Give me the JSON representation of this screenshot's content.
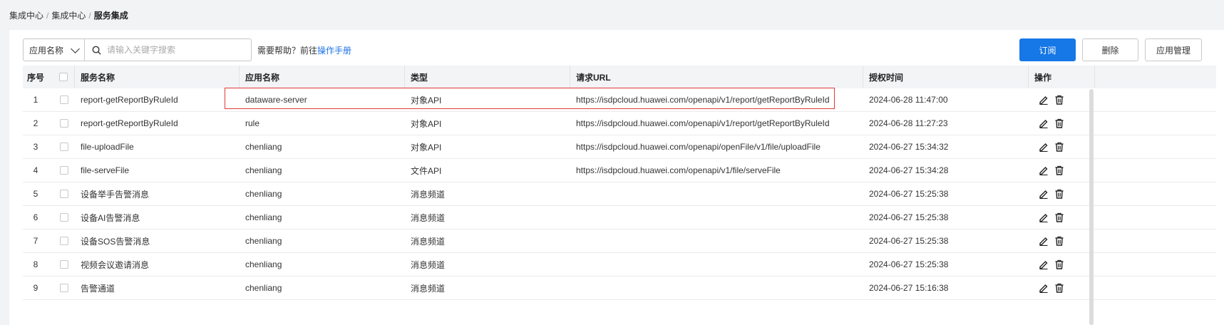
{
  "breadcrumb": {
    "items": [
      "集成中心",
      "集成中心",
      "服务集成"
    ],
    "separator": "/"
  },
  "toolbar": {
    "select_value": "应用名称",
    "search_placeholder": "请输入关键字搜索",
    "help_text": "需要帮助？前往",
    "help_link": "操作手册",
    "subscribe_label": "订阅",
    "delete_label": "删除",
    "manage_label": "应用管理"
  },
  "table": {
    "headers": {
      "no": "序号",
      "name": "服务名称",
      "app": "应用名称",
      "type": "类型",
      "url": "请求URL",
      "time": "授权时间",
      "op": "操作"
    },
    "rows": [
      {
        "no": "1",
        "name": "report-getReportByRuleId",
        "app": "dataware-server",
        "type": "对象API",
        "url": "https://isdpcloud.huawei.com/openapi/v1/report/getReportByRuleId",
        "time": "2024-06-28 11:47:00"
      },
      {
        "no": "2",
        "name": "report-getReportByRuleId",
        "app": "rule",
        "type": "对象API",
        "url": "https://isdpcloud.huawei.com/openapi/v1/report/getReportByRuleId",
        "time": "2024-06-28 11:27:23"
      },
      {
        "no": "3",
        "name": "file-uploadFile",
        "app": "chenliang",
        "type": "对象API",
        "url": "https://isdpcloud.huawei.com/openapi/openFile/v1/file/uploadFile",
        "time": "2024-06-27 15:34:32"
      },
      {
        "no": "4",
        "name": "file-serveFile",
        "app": "chenliang",
        "type": "文件API",
        "url": "https://isdpcloud.huawei.com/openapi/v1/file/serveFile",
        "time": "2024-06-27 15:34:28"
      },
      {
        "no": "5",
        "name": "设备举手告警消息",
        "app": "chenliang",
        "type": "消息频道",
        "url": "",
        "time": "2024-06-27 15:25:38"
      },
      {
        "no": "6",
        "name": "设备AI告警消息",
        "app": "chenliang",
        "type": "消息频道",
        "url": "",
        "time": "2024-06-27 15:25:38"
      },
      {
        "no": "7",
        "name": "设备SOS告警消息",
        "app": "chenliang",
        "type": "消息频道",
        "url": "",
        "time": "2024-06-27 15:25:38"
      },
      {
        "no": "8",
        "name": "视频会议邀请消息",
        "app": "chenliang",
        "type": "消息频道",
        "url": "",
        "time": "2024-06-27 15:25:38"
      },
      {
        "no": "9",
        "name": "告警通道",
        "app": "chenliang",
        "type": "消息频道",
        "url": "",
        "time": "2024-06-27 15:16:38"
      }
    ]
  },
  "icons": {
    "edit": "edit-icon",
    "delete": "trash-icon",
    "search": "search-icon",
    "dropdown": "chevron-down-icon"
  },
  "colors": {
    "primary": "#1677e6",
    "link": "#1e73e8",
    "highlight": "#e03a3a"
  }
}
